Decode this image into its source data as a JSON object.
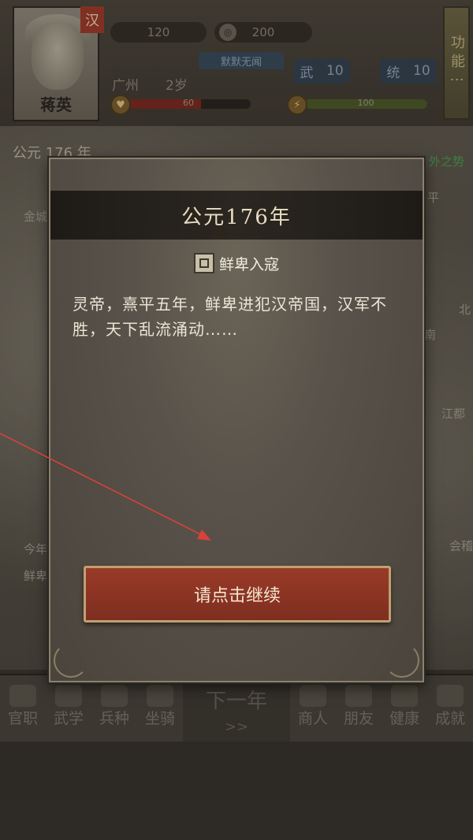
{
  "header": {
    "character_name": "蒋英",
    "nation_badge": "汉",
    "currency_1": "120",
    "currency_2": "200",
    "trait": "默默无闻",
    "location": "广州",
    "age": "2岁",
    "stat_wu_label": "武",
    "stat_wu_value": "10",
    "stat_tong_label": "统",
    "stat_tong_value": "10",
    "health_value": "60",
    "health_fraction": 0.6,
    "energy_value": "100",
    "energy_fraction": 1.0,
    "function_button": "功能⋮"
  },
  "background": {
    "year_label": "公元 176 年",
    "map_labels": [
      "金城",
      "平",
      "北",
      "南",
      "江都",
      "会稽",
      "今年",
      "鲜卑"
    ],
    "event_tag": "外之势"
  },
  "modal": {
    "title": "公元176年",
    "event_title": "鲜卑入寇",
    "event_body": "灵帝，熹平五年，鲜卑进犯汉帝国，汉军不胜，天下乱流涌动……",
    "continue_button": "请点击继续"
  },
  "bottom_nav": {
    "items": [
      {
        "label": "官职"
      },
      {
        "label": "武学"
      },
      {
        "label": "兵种"
      },
      {
        "label": "坐骑"
      },
      {
        "label": "商人"
      },
      {
        "label": "朋友"
      },
      {
        "label": "健康"
      },
      {
        "label": "成就"
      }
    ],
    "next_year_label": "下一年",
    "next_year_arrow": ">>"
  },
  "colors": {
    "accent_red": "#8a3322",
    "modal_header": "#1e1b17",
    "annotation_arrow": "#d9423a"
  }
}
